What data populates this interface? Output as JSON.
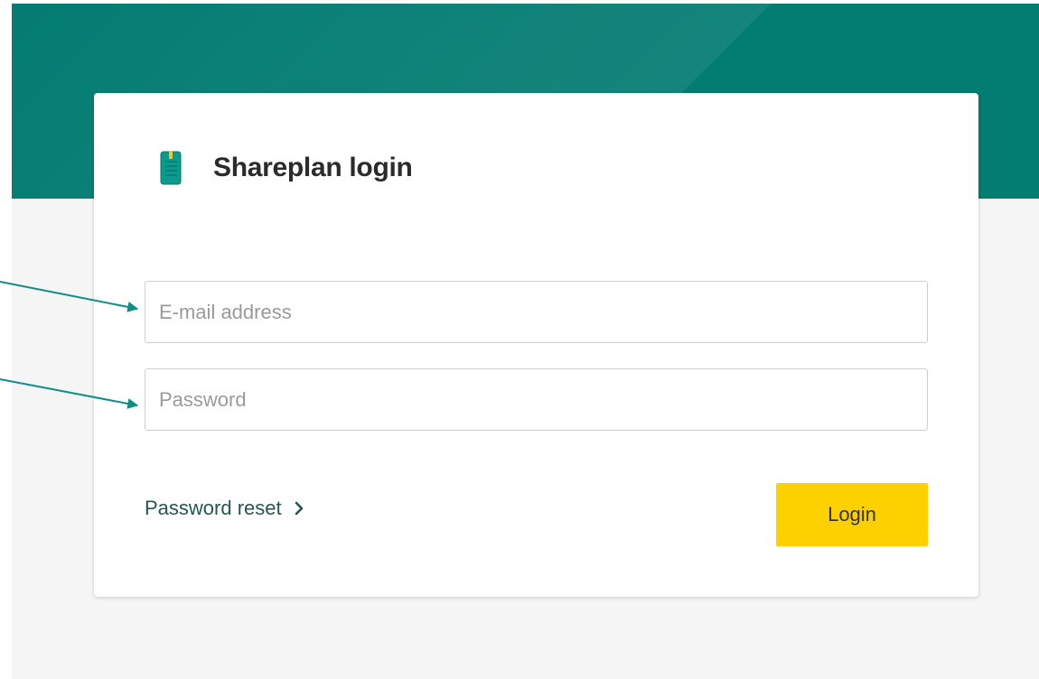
{
  "login": {
    "title": "Shareplan login",
    "email_placeholder": "E-mail address",
    "password_placeholder": "Password",
    "password_reset_label": "Password reset",
    "login_button_label": "Login"
  },
  "icons": {
    "app": "notebook-icon",
    "reset": "chevron-right-icon"
  },
  "colors": {
    "header": "#037c72",
    "accent": "#0a9b8e",
    "button": "#fdd000",
    "page_background": "#f5f5f5",
    "annotation": "#0f8f86"
  }
}
